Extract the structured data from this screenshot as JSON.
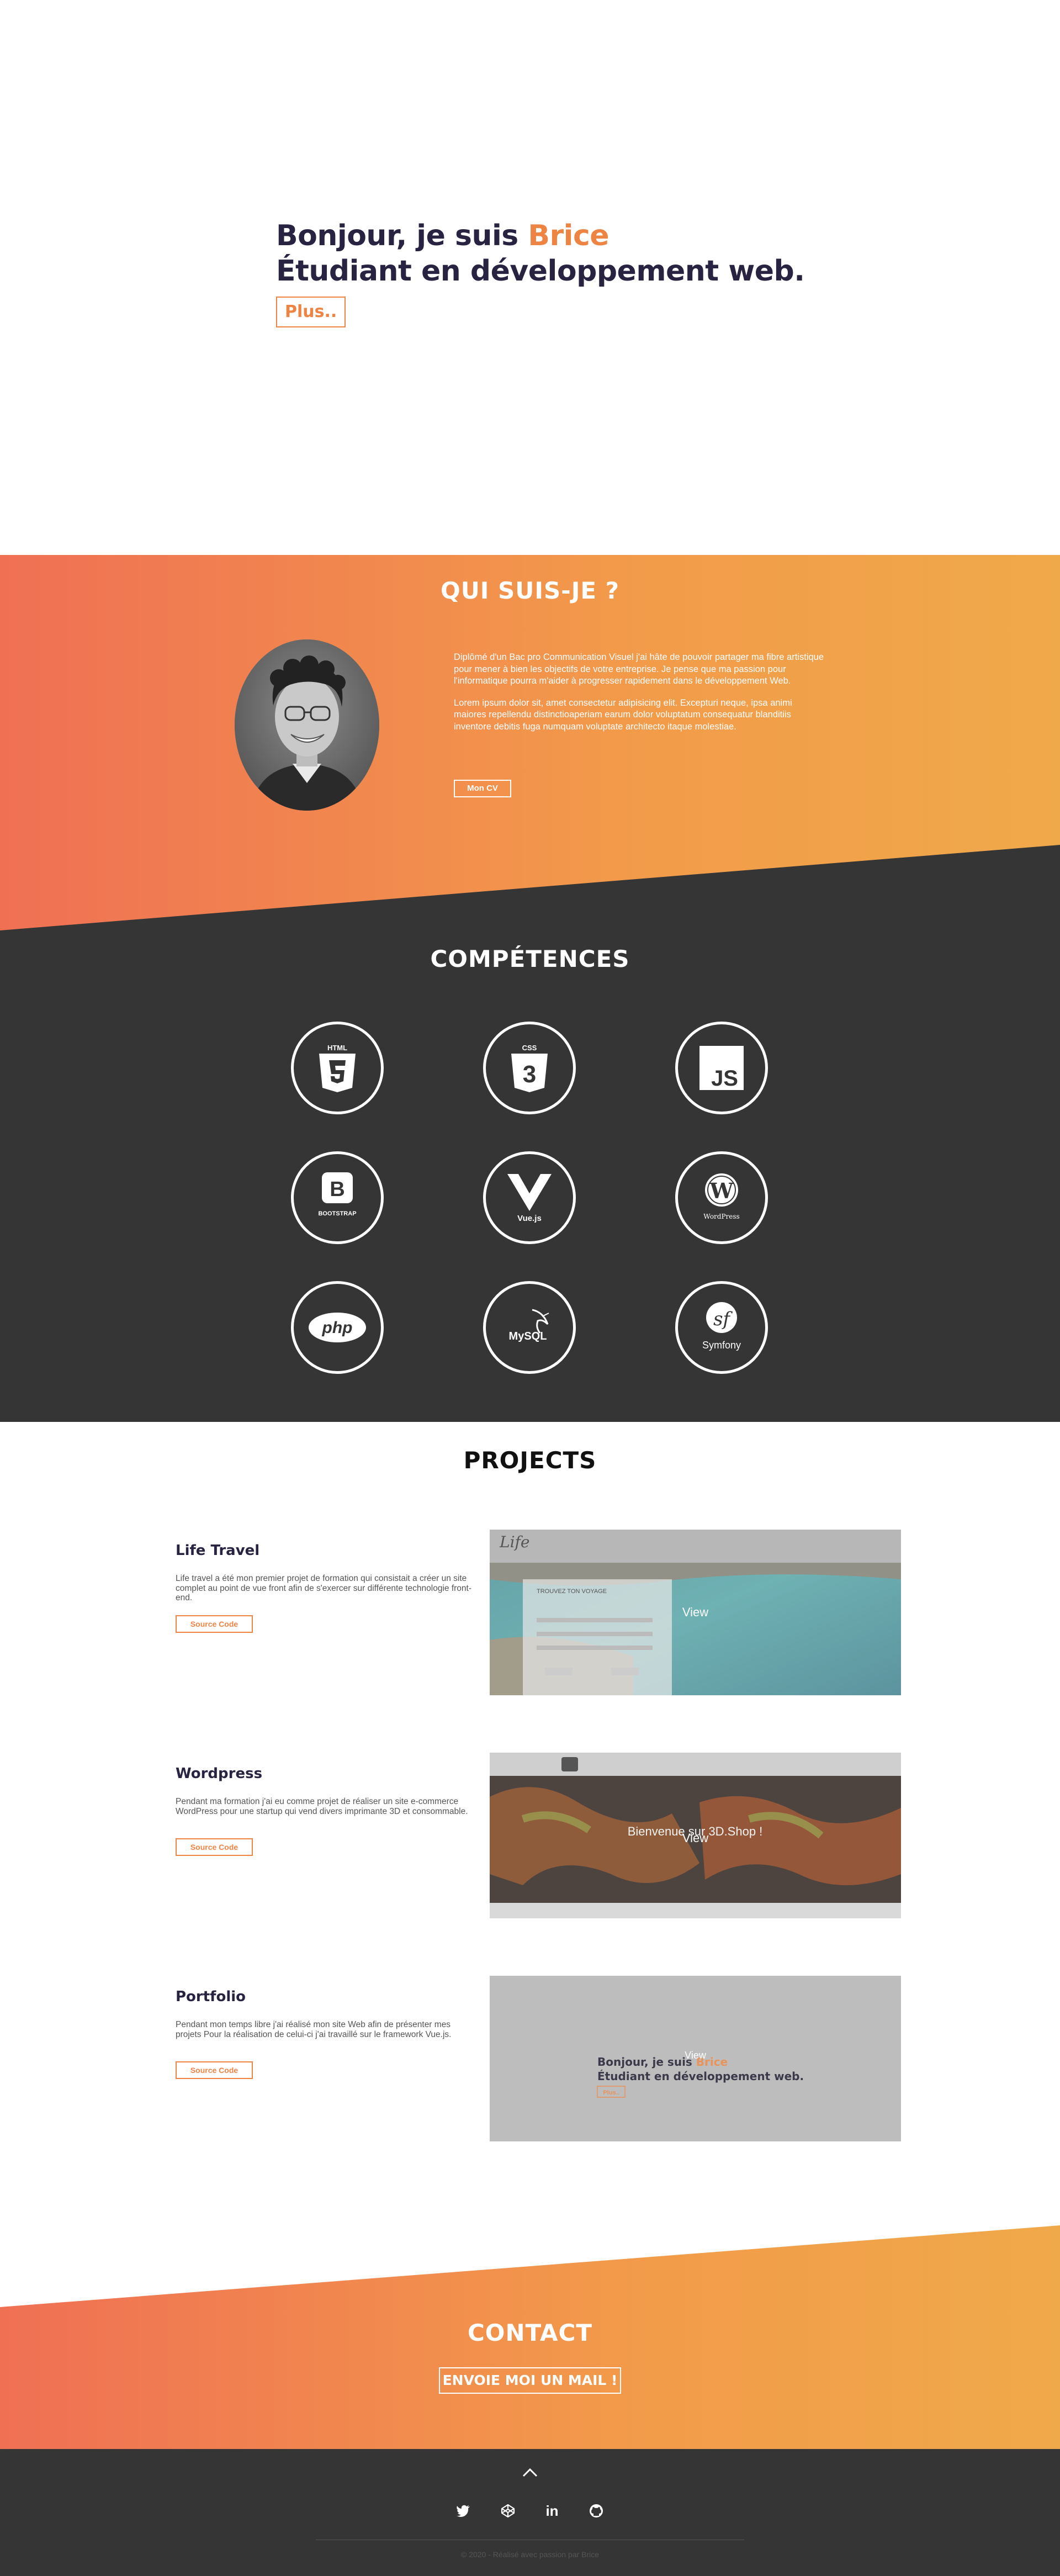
{
  "hero": {
    "greeting": "Bonjour, je suis ",
    "name": "Brice",
    "subtitle": "Étudiant en développement web.",
    "button": "Plus.."
  },
  "about": {
    "title": "QUI SUIS-JE ?",
    "paragraph1": "Diplômé d'un Bac pro Communication Visuel j'ai hâte de pouvoir partager ma fibre artistique pour mener à bien les objectifs de votre entreprise. Je pense que ma passion pour l'informatique pourra m'aider à progresser rapidement dans le développement Web.",
    "paragraph2": "Lorem ipsum dolor sit, amet consectetur adipisicing elit. Excepturi neque, ipsa animi maiores repellendu distinctioaperiam earum dolor voluptatum consequatur blanditiis inventore debitis fuga numquam voluptate architecto itaque molestiae.",
    "cv_button": "Mon CV"
  },
  "skills": {
    "title": "COMPÉTENCES",
    "items": [
      {
        "icon": "html5-icon",
        "label": "HTML"
      },
      {
        "icon": "css3-icon",
        "label": "CSS"
      },
      {
        "icon": "javascript-icon",
        "label": "JS"
      },
      {
        "icon": "bootstrap-icon",
        "label": "BOOTSTRAP"
      },
      {
        "icon": "vuejs-icon",
        "label": "Vue.js"
      },
      {
        "icon": "wordpress-icon",
        "label": "WordPress"
      },
      {
        "icon": "php-icon",
        "label": "php"
      },
      {
        "icon": "mysql-icon",
        "label": "MySQL"
      },
      {
        "icon": "symfony-icon",
        "label": "Symfony"
      }
    ]
  },
  "projects": {
    "title": "PROJECTS",
    "items": [
      {
        "name": "Life Travel",
        "description": "Life travel a été mon premier projet de formation qui consistait a créer un site complet au point de vue front afin de s'exercer sur différente technologie front-end.",
        "button": "Source Code",
        "overlay": "View",
        "preview_logo": "Life",
        "preview_form": "TROUVEZ TON VOYAGE"
      },
      {
        "name": "Wordpress",
        "description": "Pendant ma formation j'ai eu comme projet de réaliser un site e-commerce WordPress pour une startup qui vend divers imprimante 3D et consommable.",
        "button": "Source Code",
        "overlay": "View",
        "preview_heading": "Bienvenue sur 3D.Shop !"
      },
      {
        "name": "Portfolio",
        "description": "Pendant mon temps libre j'ai réalisé mon site Web afin de présenter mes projets Pour la réalisation de celui-ci j'ai travaillé sur le framework Vue.js.",
        "button": "Source Code",
        "overlay": "View",
        "preview_greeting": "Bonjour, je suis ",
        "preview_name": "Brice",
        "preview_subtitle": "Étudiant en développement web.",
        "preview_button": "Plus.."
      }
    ]
  },
  "contact": {
    "title": "CONTACT",
    "button": "ENVOIE MOI UN MAIL !"
  },
  "footer": {
    "icons": [
      "chevron-up-icon",
      "twitter-icon",
      "codepen-icon",
      "linkedin-icon",
      "github-icon"
    ],
    "linkedin_label": "in",
    "copyright": "© 2020 - Réalisé avec passion par Brice"
  },
  "colors": {
    "accent": "#ee8443",
    "dark": "#353535",
    "navy": "#272341"
  }
}
